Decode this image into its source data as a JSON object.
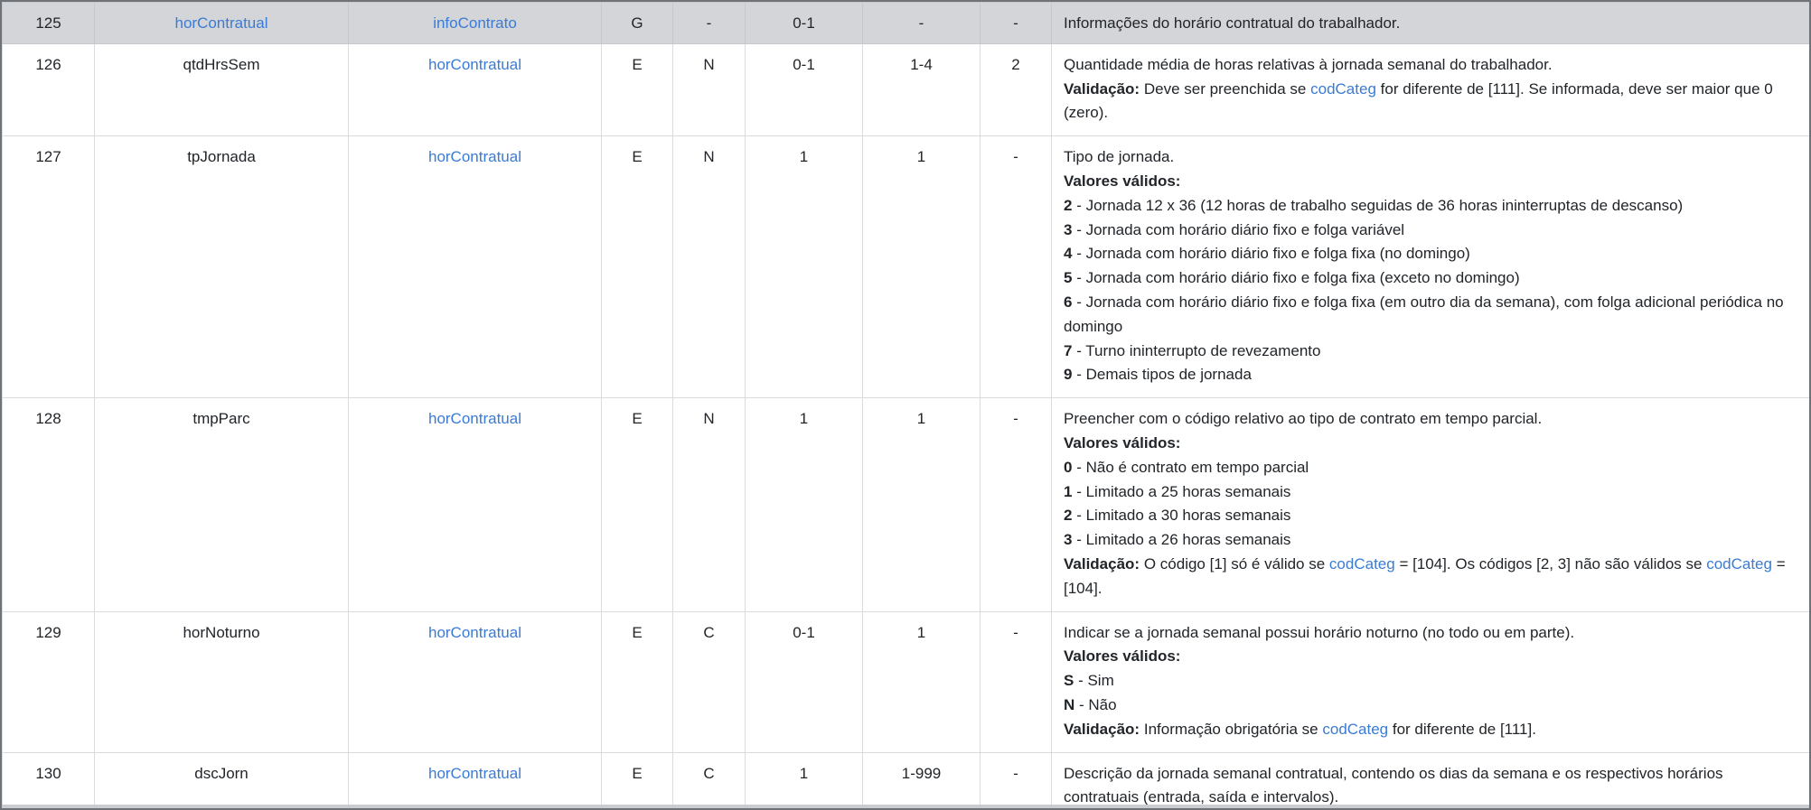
{
  "rows": [
    {
      "num": "125",
      "name": "horContratual",
      "parent": "infoContrato",
      "ele": "G",
      "tipo": "-",
      "ocor": "0-1",
      "tam": "-",
      "dec": "-",
      "desc": "Informações do horário contratual do trabalhador."
    },
    {
      "num": "126",
      "name": "qtdHrsSem",
      "parent": "horContratual",
      "ele": "E",
      "tipo": "N",
      "ocor": "0-1",
      "tam": "1-4",
      "dec": "2",
      "desc": "Quantidade média de horas relativas à jornada semanal do trabalhador.",
      "validacao_label": "Validação:",
      "validacao_1": "Deve ser preenchida se",
      "validacao_link": "codCateg",
      "validacao_2": "for diferente de [111]. Se informada, deve ser maior que 0 (zero)."
    },
    {
      "num": "127",
      "name": "tpJornada",
      "parent": "horContratual",
      "ele": "E",
      "tipo": "N",
      "ocor": "1",
      "tam": "1",
      "dec": "-",
      "desc": "Tipo de jornada.",
      "valores_label": "Valores válidos:",
      "values": [
        {
          "code": "2",
          "text": "- Jornada 12 x 36 (12 horas de trabalho seguidas de 36 horas ininterruptas de descanso)"
        },
        {
          "code": "3",
          "text": "- Jornada com horário diário fixo e folga variável"
        },
        {
          "code": "4",
          "text": "- Jornada com horário diário fixo e folga fixa (no domingo)"
        },
        {
          "code": "5",
          "text": "- Jornada com horário diário fixo e folga fixa (exceto no domingo)"
        },
        {
          "code": "6",
          "text": "- Jornada com horário diário fixo e folga fixa (em outro dia da semana), com folga adicional periódica no domingo"
        },
        {
          "code": "7",
          "text": "- Turno ininterrupto de revezamento"
        },
        {
          "code": "9",
          "text": "- Demais tipos de jornada"
        }
      ]
    },
    {
      "num": "128",
      "name": "tmpParc",
      "parent": "horContratual",
      "ele": "E",
      "tipo": "N",
      "ocor": "1",
      "tam": "1",
      "dec": "-",
      "desc": "Preencher com o código relativo ao tipo de contrato em tempo parcial.",
      "valores_label": "Valores válidos:",
      "values": [
        {
          "code": "0",
          "text": "- Não é contrato em tempo parcial"
        },
        {
          "code": "1",
          "text": "- Limitado a 25 horas semanais"
        },
        {
          "code": "2",
          "text": "- Limitado a 30 horas semanais"
        },
        {
          "code": "3",
          "text": "- Limitado a 26 horas semanais"
        }
      ],
      "validacao_label": "Validação:",
      "validacao_1": "O código [1] só é válido se",
      "validacao_link": "codCateg",
      "validacao_2": "= [104]. Os códigos [2, 3] não são válidos se",
      "validacao_link_2": "codCateg",
      "validacao_3": "= [104]."
    },
    {
      "num": "129",
      "name": "horNoturno",
      "parent": "horContratual",
      "ele": "E",
      "tipo": "C",
      "ocor": "0-1",
      "tam": "1",
      "dec": "-",
      "desc": "Indicar se a jornada semanal possui horário noturno (no todo ou em parte).",
      "valores_label": "Valores válidos:",
      "values": [
        {
          "code": "S",
          "text": "- Sim"
        },
        {
          "code": "N",
          "text": "- Não"
        }
      ],
      "validacao_label": "Validação:",
      "validacao_1": "Informação obrigatória se",
      "validacao_link": "codCateg",
      "validacao_2": "for diferente de [111]."
    },
    {
      "num": "130",
      "name": "dscJorn",
      "parent": "horContratual",
      "ele": "E",
      "tipo": "C",
      "ocor": "1",
      "tam": "1-999",
      "dec": "-",
      "desc": "Descrição da jornada semanal contratual, contendo os dias da semana e os respectivos horários contratuais (entrada, saída e intervalos)."
    }
  ]
}
